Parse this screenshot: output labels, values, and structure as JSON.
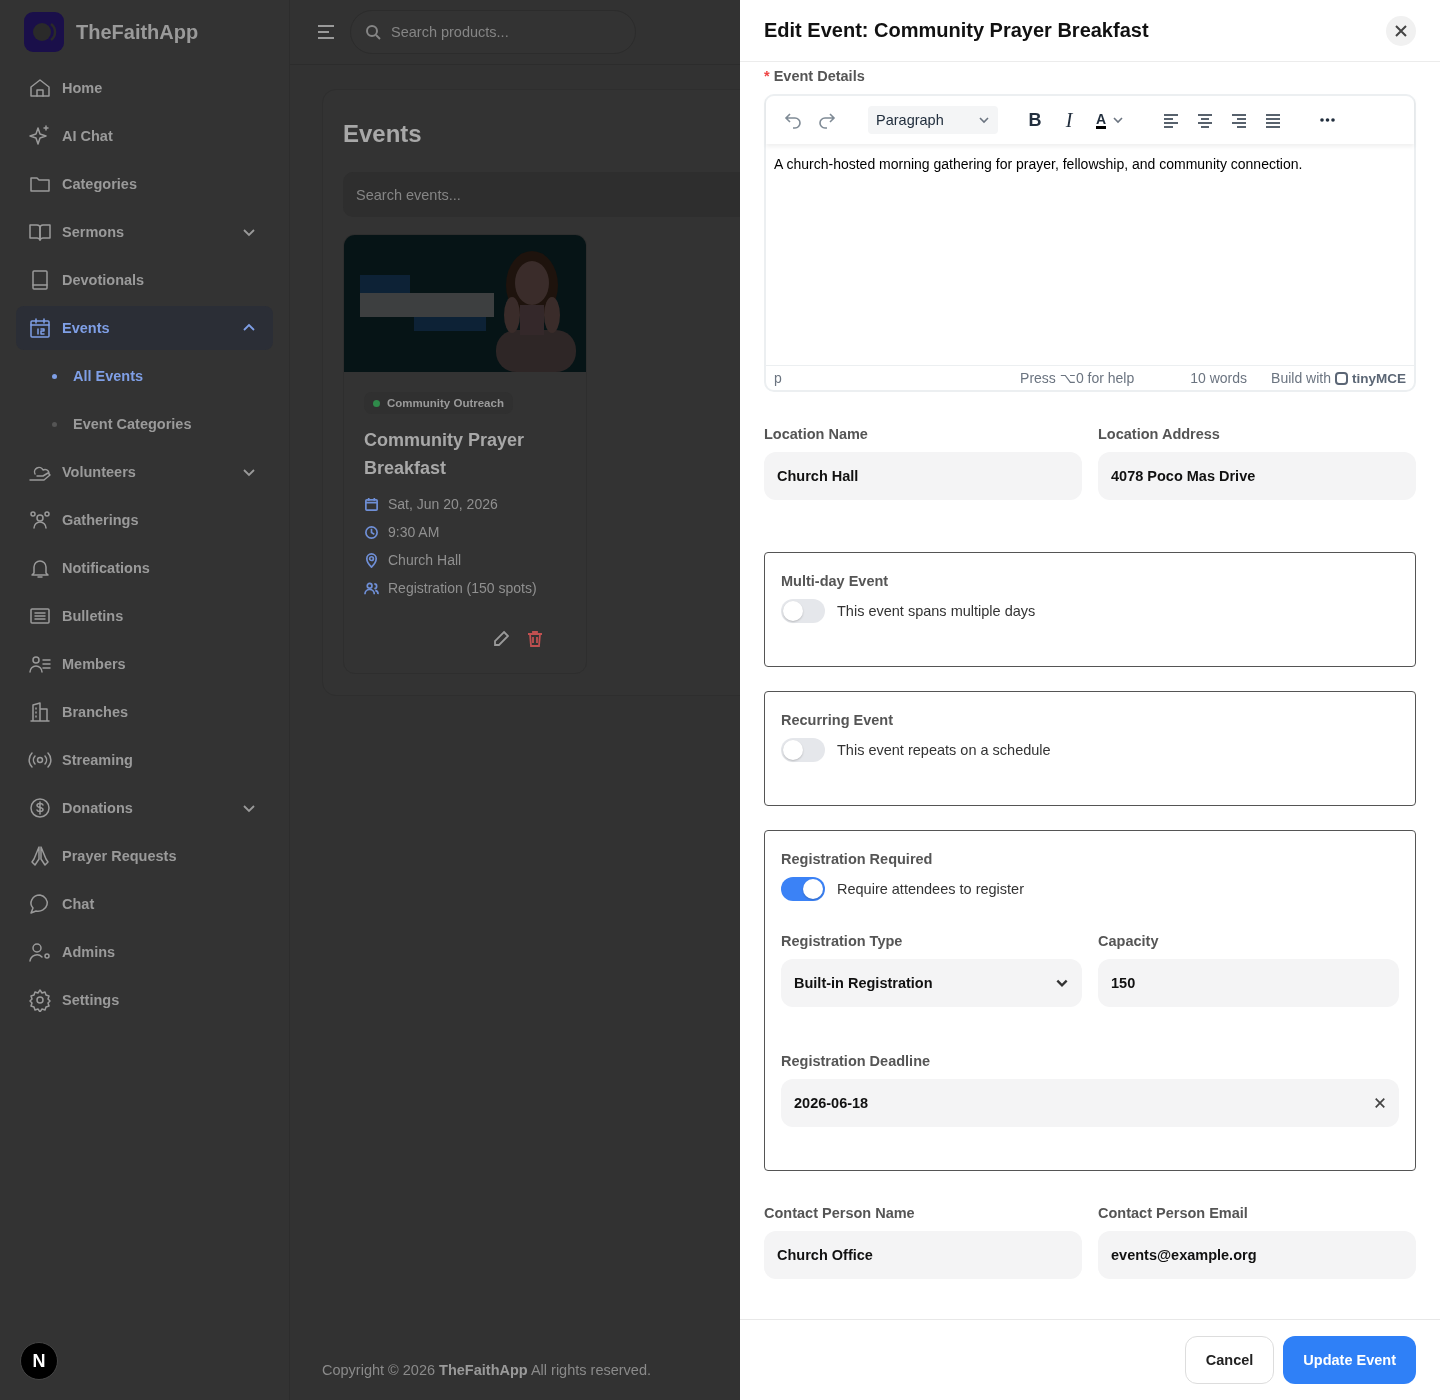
{
  "sidebar": {
    "brand": "TheFaithApp",
    "items": [
      {
        "label": "Home",
        "kind": "link",
        "selected": false
      },
      {
        "label": "AI Chat",
        "kind": "link",
        "selected": false
      },
      {
        "label": "Categories",
        "kind": "link",
        "selected": false
      },
      {
        "label": "Sermons",
        "kind": "group",
        "selected": false,
        "expanded": false
      },
      {
        "label": "Devotionals",
        "kind": "link",
        "selected": false
      },
      {
        "label": "Events",
        "kind": "group",
        "selected": true,
        "expanded": true,
        "children": [
          {
            "label": "All Events",
            "selected": true
          },
          {
            "label": "Event Categories",
            "selected": false
          }
        ]
      },
      {
        "label": "Volunteers",
        "kind": "group",
        "selected": false,
        "expanded": false
      },
      {
        "label": "Gatherings",
        "kind": "link",
        "selected": false
      },
      {
        "label": "Notifications",
        "kind": "link",
        "selected": false
      },
      {
        "label": "Bulletins",
        "kind": "link",
        "selected": false
      },
      {
        "label": "Members",
        "kind": "link",
        "selected": false
      },
      {
        "label": "Branches",
        "kind": "link",
        "selected": false
      },
      {
        "label": "Streaming",
        "kind": "link",
        "selected": false
      },
      {
        "label": "Donations",
        "kind": "group",
        "selected": false,
        "expanded": false
      },
      {
        "label": "Prayer Requests",
        "kind": "link",
        "selected": false
      },
      {
        "label": "Chat",
        "kind": "link",
        "selected": false
      },
      {
        "label": "Admins",
        "kind": "link",
        "selected": false
      },
      {
        "label": "Settings",
        "kind": "link",
        "selected": false
      }
    ],
    "dev_badge": "N"
  },
  "topbar": {
    "search": {
      "placeholder": "Search products..."
    }
  },
  "page": {
    "title": "Events",
    "search": {
      "placeholder": "Search events..."
    },
    "events": [
      {
        "category": "Community Outreach",
        "title": "Community Prayer Breakfast",
        "date": "Sat, Jun 20, 2026",
        "time": "9:30 AM",
        "location": "Church Hall",
        "registration": "Registration (150 spots)"
      }
    ]
  },
  "footer": "Copyright © 2026 **TheFaithApp** All rights reserved.",
  "drawer": {
    "title": "Edit Event: Community Prayer Breakfast",
    "description": {
      "label": "Event Details",
      "required_mark": "*",
      "format": "Paragraph",
      "toolbar": [
        {
          "kind": "undo"
        },
        {
          "kind": "redo"
        },
        {
          "kind": "format"
        },
        {
          "kind": "bold",
          "glyph": "B"
        },
        {
          "kind": "italic",
          "glyph": "I"
        },
        {
          "kind": "color",
          "glyph": "A"
        },
        {
          "kind": "align-left"
        },
        {
          "kind": "align-center"
        },
        {
          "kind": "align-right"
        },
        {
          "kind": "justify"
        },
        {
          "kind": "more"
        }
      ],
      "content": "A church-hosted morning gathering for prayer, fellowship, and community connection.",
      "path": "p",
      "help": "Press ⌥0 for help",
      "word_count": "10 words",
      "branding": "Build with",
      "brand": "tinyMCE"
    },
    "location_name": {
      "label": "Location Name",
      "value": "Church Hall"
    },
    "location_address": {
      "label": "Location Address",
      "value": "4078 Poco Mas Drive"
    },
    "options": [
      {
        "label": "Multi-day Event",
        "description": "This event spans multiple days",
        "on": false
      },
      {
        "label": "Recurring Event",
        "description": "This event repeats on a schedule",
        "on": false
      },
      {
        "label": "Registration Required",
        "description": "Require attendees to register",
        "on": true,
        "registration_type": {
          "label": "Registration Type",
          "value": "Built-in Registration"
        },
        "capacity": {
          "label": "Capacity",
          "value": "150"
        },
        "deadline": {
          "label": "Registration Deadline",
          "value": "2026-06-18"
        }
      }
    ],
    "contact_name": {
      "label": "Contact Person Name",
      "value": "Church Office"
    },
    "contact_email": {
      "label": "Contact Person Email",
      "value": "events@example.org"
    },
    "buttons": {
      "cancel": "Cancel",
      "submit": "Update Event"
    }
  }
}
